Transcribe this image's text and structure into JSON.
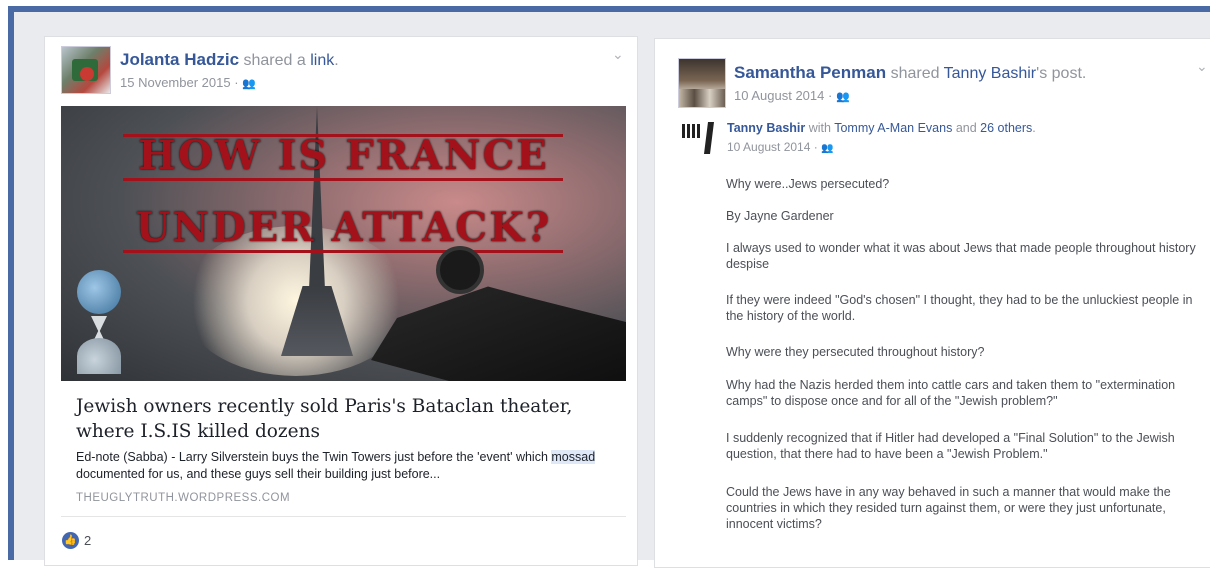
{
  "left_post": {
    "author": "Jolanta Hadzic",
    "action_text": "shared a",
    "action_link": "link",
    "action_period": ".",
    "date": "15 November 2015",
    "separator": "·",
    "audience_icon": "friends-icon",
    "hero_line1": "HOW IS FRANCE",
    "hero_line2": "UNDER ATTACK?",
    "link_title": "Jewish owners recently sold Paris's Bataclan theater, where I.S.IS killed dozens",
    "link_desc_part1": "Ed-note (Sabba) - Larry Silverstein buys the Twin Towers just before the 'event' which ",
    "link_desc_highlight": "mossad",
    "link_desc_part2": " documented for us, and these guys sell their building just before...",
    "link_domain": "THEUGLYTRUTH.WORDPRESS.COM",
    "like_count": "2"
  },
  "right_post": {
    "author": "Samantha Penman",
    "action_text": "shared",
    "shared_from": "Tanny Bashir",
    "shared_suffix": "'s post.",
    "date": "10 August 2014",
    "separator": "·",
    "inner_author": "Tanny Bashir",
    "inner_with": "with",
    "inner_tagged": "Tommy A-Man Evans",
    "inner_and": "and",
    "inner_others": "26 others",
    "inner_period": ".",
    "inner_date": "10 August 2014",
    "paragraphs": [
      "Why were..Jews persecuted?",
      "By Jayne Gardener",
      "I always used to wonder what it was about Jews that made people throughout history despise",
      "If they were indeed \"God's chosen\" I thought, they had to be the unluckiest people in the history of the world.",
      "Why were they persecuted throughout history?",
      "Why had the Nazis herded them into cattle cars and taken them to \"extermination camps\" to dispose once and for all of the \"Jewish problem?\"",
      "I suddenly recognized that if Hitler had developed a \"Final Solution\" to the Jewish question, that there had to have been a \"Jewish Problem.\"",
      "Could the Jews have in any way behaved in such a manner that would make the countries in which they resided turn against them, or were they just unfortunate, innocent victims?"
    ]
  }
}
